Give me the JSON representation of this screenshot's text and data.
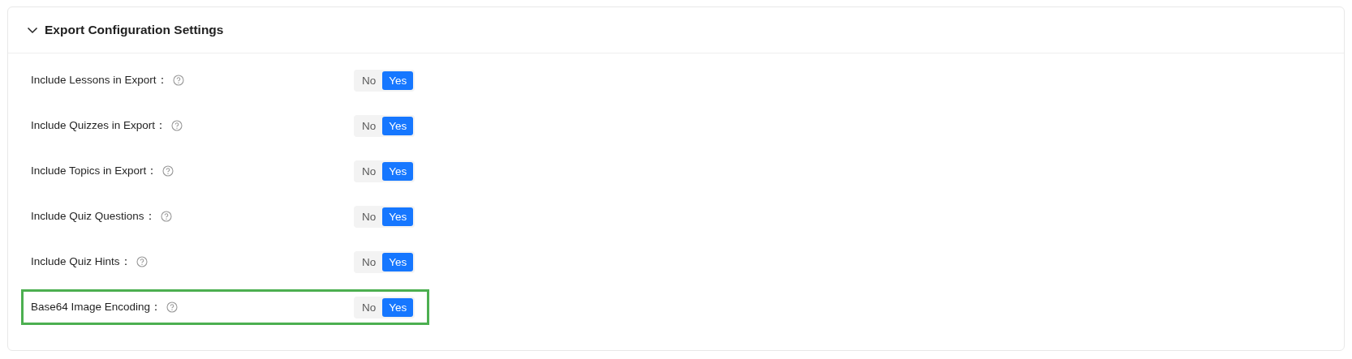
{
  "panel": {
    "title": "Export Configuration Settings",
    "expanded": true
  },
  "settings": [
    {
      "label": "Include Lessons in Export：",
      "options": [
        {
          "label": "No",
          "selected": false
        },
        {
          "label": "Yes",
          "selected": true
        }
      ],
      "highlighted": false
    },
    {
      "label": "Include Quizzes in Export：",
      "options": [
        {
          "label": "No",
          "selected": false
        },
        {
          "label": "Yes",
          "selected": true
        }
      ],
      "highlighted": false
    },
    {
      "label": "Include Topics in Export：",
      "options": [
        {
          "label": "No",
          "selected": false
        },
        {
          "label": "Yes",
          "selected": true
        }
      ],
      "highlighted": false
    },
    {
      "label": "Include Quiz Questions：",
      "options": [
        {
          "label": "No",
          "selected": false
        },
        {
          "label": "Yes",
          "selected": true
        }
      ],
      "highlighted": false
    },
    {
      "label": "Include Quiz Hints：",
      "options": [
        {
          "label": "No",
          "selected": false
        },
        {
          "label": "Yes",
          "selected": true
        }
      ],
      "highlighted": false
    },
    {
      "label": "Base64 Image Encoding：",
      "options": [
        {
          "label": "No",
          "selected": false
        },
        {
          "label": "Yes",
          "selected": true
        }
      ],
      "highlighted": true
    }
  ]
}
